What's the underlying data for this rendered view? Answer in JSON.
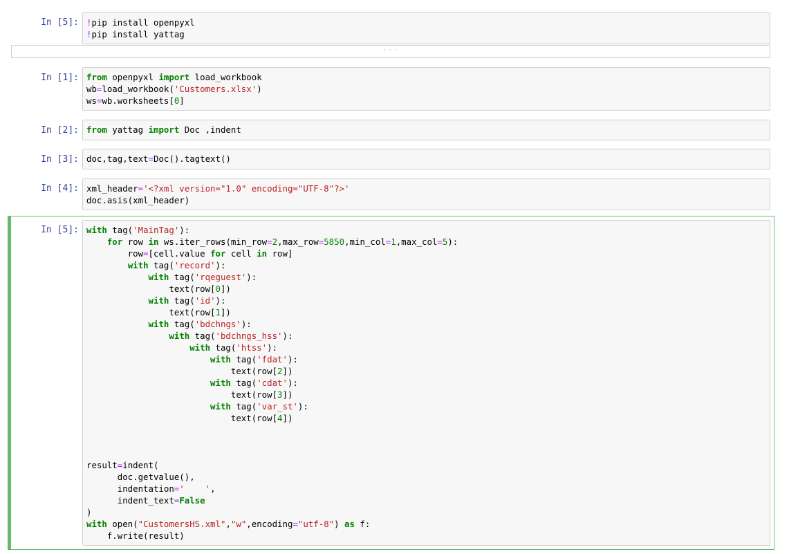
{
  "cells": [
    {
      "prompt": "In [5]:",
      "lines": [
        [
          [
            "cm",
            "!"
          ],
          [
            "t",
            "pip install openpyxl"
          ]
        ],
        [
          [
            "cm",
            "!"
          ],
          [
            "t",
            "pip install yattag"
          ]
        ]
      ]
    },
    {
      "prompt": "In [1]:",
      "lines": [
        [
          [
            "kw",
            "from"
          ],
          [
            "t",
            " openpyxl "
          ],
          [
            "kw",
            "import"
          ],
          [
            "t",
            " load_workbook"
          ]
        ],
        [
          [
            "t",
            "wb"
          ],
          [
            "op",
            "="
          ],
          [
            "t",
            "load_workbook("
          ],
          [
            "st",
            "'Customers.xlsx'"
          ],
          [
            "t",
            ")"
          ]
        ],
        [
          [
            "t",
            "ws"
          ],
          [
            "op",
            "="
          ],
          [
            "t",
            "wb.worksheets["
          ],
          [
            "nu",
            "0"
          ],
          [
            "t",
            "]"
          ]
        ]
      ]
    },
    {
      "prompt": "In [2]:",
      "lines": [
        [
          [
            "kw",
            "from"
          ],
          [
            "t",
            " yattag "
          ],
          [
            "kw",
            "import"
          ],
          [
            "t",
            " Doc ,indent"
          ]
        ]
      ]
    },
    {
      "prompt": "In [3]:",
      "lines": [
        [
          [
            "t",
            "doc,tag,text"
          ],
          [
            "op",
            "="
          ],
          [
            "t",
            "Doc().tagtext()"
          ]
        ]
      ]
    },
    {
      "prompt": "In [4]:",
      "lines": [
        [
          [
            "t",
            "xml_header"
          ],
          [
            "op",
            "="
          ],
          [
            "st",
            "'<?xml version=\"1.0\" encoding=\"UTF-8\"?>'"
          ]
        ],
        [
          [
            "t",
            "doc.asis(xml_header)"
          ]
        ]
      ]
    },
    {
      "prompt": "In [5]:",
      "lines": [
        [
          [
            "kw",
            "with"
          ],
          [
            "t",
            " tag("
          ],
          [
            "st",
            "'MainTag'"
          ],
          [
            "t",
            "):"
          ]
        ],
        [
          [
            "t",
            "    "
          ],
          [
            "kw",
            "for"
          ],
          [
            "t",
            " row "
          ],
          [
            "kw",
            "in"
          ],
          [
            "t",
            " ws.iter_rows(min_row"
          ],
          [
            "op",
            "="
          ],
          [
            "nu",
            "2"
          ],
          [
            "t",
            ",max_row"
          ],
          [
            "op",
            "="
          ],
          [
            "nu",
            "5850"
          ],
          [
            "t",
            ",min_col"
          ],
          [
            "op",
            "="
          ],
          [
            "nu",
            "1"
          ],
          [
            "t",
            ",max_col"
          ],
          [
            "op",
            "="
          ],
          [
            "nu",
            "5"
          ],
          [
            "t",
            "):"
          ]
        ],
        [
          [
            "t",
            "        row"
          ],
          [
            "op",
            "="
          ],
          [
            "t",
            "[cell.value "
          ],
          [
            "kw",
            "for"
          ],
          [
            "t",
            " cell "
          ],
          [
            "kw",
            "in"
          ],
          [
            "t",
            " row]"
          ]
        ],
        [
          [
            "t",
            "        "
          ],
          [
            "kw",
            "with"
          ],
          [
            "t",
            " tag("
          ],
          [
            "st",
            "'record'"
          ],
          [
            "t",
            "):"
          ]
        ],
        [
          [
            "t",
            "            "
          ],
          [
            "kw",
            "with"
          ],
          [
            "t",
            " tag("
          ],
          [
            "st",
            "'rqeguest'"
          ],
          [
            "t",
            "):"
          ]
        ],
        [
          [
            "t",
            "                text(row["
          ],
          [
            "nu",
            "0"
          ],
          [
            "t",
            "])"
          ]
        ],
        [
          [
            "t",
            "            "
          ],
          [
            "kw",
            "with"
          ],
          [
            "t",
            " tag("
          ],
          [
            "st",
            "'id'"
          ],
          [
            "t",
            "):"
          ]
        ],
        [
          [
            "t",
            "                text(row["
          ],
          [
            "nu",
            "1"
          ],
          [
            "t",
            "])"
          ]
        ],
        [
          [
            "t",
            "            "
          ],
          [
            "kw",
            "with"
          ],
          [
            "t",
            " tag("
          ],
          [
            "st",
            "'bdchngs'"
          ],
          [
            "t",
            "):"
          ]
        ],
        [
          [
            "t",
            "                "
          ],
          [
            "kw",
            "with"
          ],
          [
            "t",
            " tag("
          ],
          [
            "st",
            "'bdchngs_hss'"
          ],
          [
            "t",
            "):"
          ]
        ],
        [
          [
            "t",
            "                    "
          ],
          [
            "kw",
            "with"
          ],
          [
            "t",
            " tag("
          ],
          [
            "st",
            "'htss'"
          ],
          [
            "t",
            "):"
          ]
        ],
        [
          [
            "t",
            "                        "
          ],
          [
            "kw",
            "with"
          ],
          [
            "t",
            " tag("
          ],
          [
            "st",
            "'fdat'"
          ],
          [
            "t",
            "):"
          ]
        ],
        [
          [
            "t",
            "                            text(row["
          ],
          [
            "nu",
            "2"
          ],
          [
            "t",
            "])"
          ]
        ],
        [
          [
            "t",
            "                        "
          ],
          [
            "kw",
            "with"
          ],
          [
            "t",
            " tag("
          ],
          [
            "st",
            "'cdat'"
          ],
          [
            "t",
            "):"
          ]
        ],
        [
          [
            "t",
            "                            text(row["
          ],
          [
            "nu",
            "3"
          ],
          [
            "t",
            "])"
          ]
        ],
        [
          [
            "t",
            "                        "
          ],
          [
            "kw",
            "with"
          ],
          [
            "t",
            " tag("
          ],
          [
            "st",
            "'var_st'"
          ],
          [
            "t",
            "):"
          ]
        ],
        [
          [
            "t",
            "                            text(row["
          ],
          [
            "nu",
            "4"
          ],
          [
            "t",
            "])"
          ]
        ],
        [
          [
            "t",
            ""
          ]
        ],
        [
          [
            "t",
            ""
          ]
        ],
        [
          [
            "t",
            ""
          ]
        ],
        [
          [
            "t",
            "result"
          ],
          [
            "op",
            "="
          ],
          [
            "t",
            "indent("
          ]
        ],
        [
          [
            "t",
            "      doc.getvalue(),"
          ]
        ],
        [
          [
            "t",
            "      indentation"
          ],
          [
            "op",
            "="
          ],
          [
            "st",
            "'    '"
          ],
          [
            "t",
            ","
          ]
        ],
        [
          [
            "t",
            "      indent_text"
          ],
          [
            "op",
            "="
          ],
          [
            "kw",
            "False"
          ]
        ],
        [
          [
            "t",
            ")"
          ]
        ],
        [
          [
            "kw",
            "with"
          ],
          [
            "t",
            " open("
          ],
          [
            "st",
            "\"CustomersHS.xml\""
          ],
          [
            "t",
            ","
          ],
          [
            "st",
            "\"w\""
          ],
          [
            "t",
            ",encoding"
          ],
          [
            "op",
            "="
          ],
          [
            "st",
            "\"utf-8\""
          ],
          [
            "t",
            ") "
          ],
          [
            "kw",
            "as"
          ],
          [
            "t",
            " f:"
          ]
        ],
        [
          [
            "t",
            "    f.write(result)"
          ]
        ]
      ]
    }
  ],
  "collapsed_label": "· · ·"
}
